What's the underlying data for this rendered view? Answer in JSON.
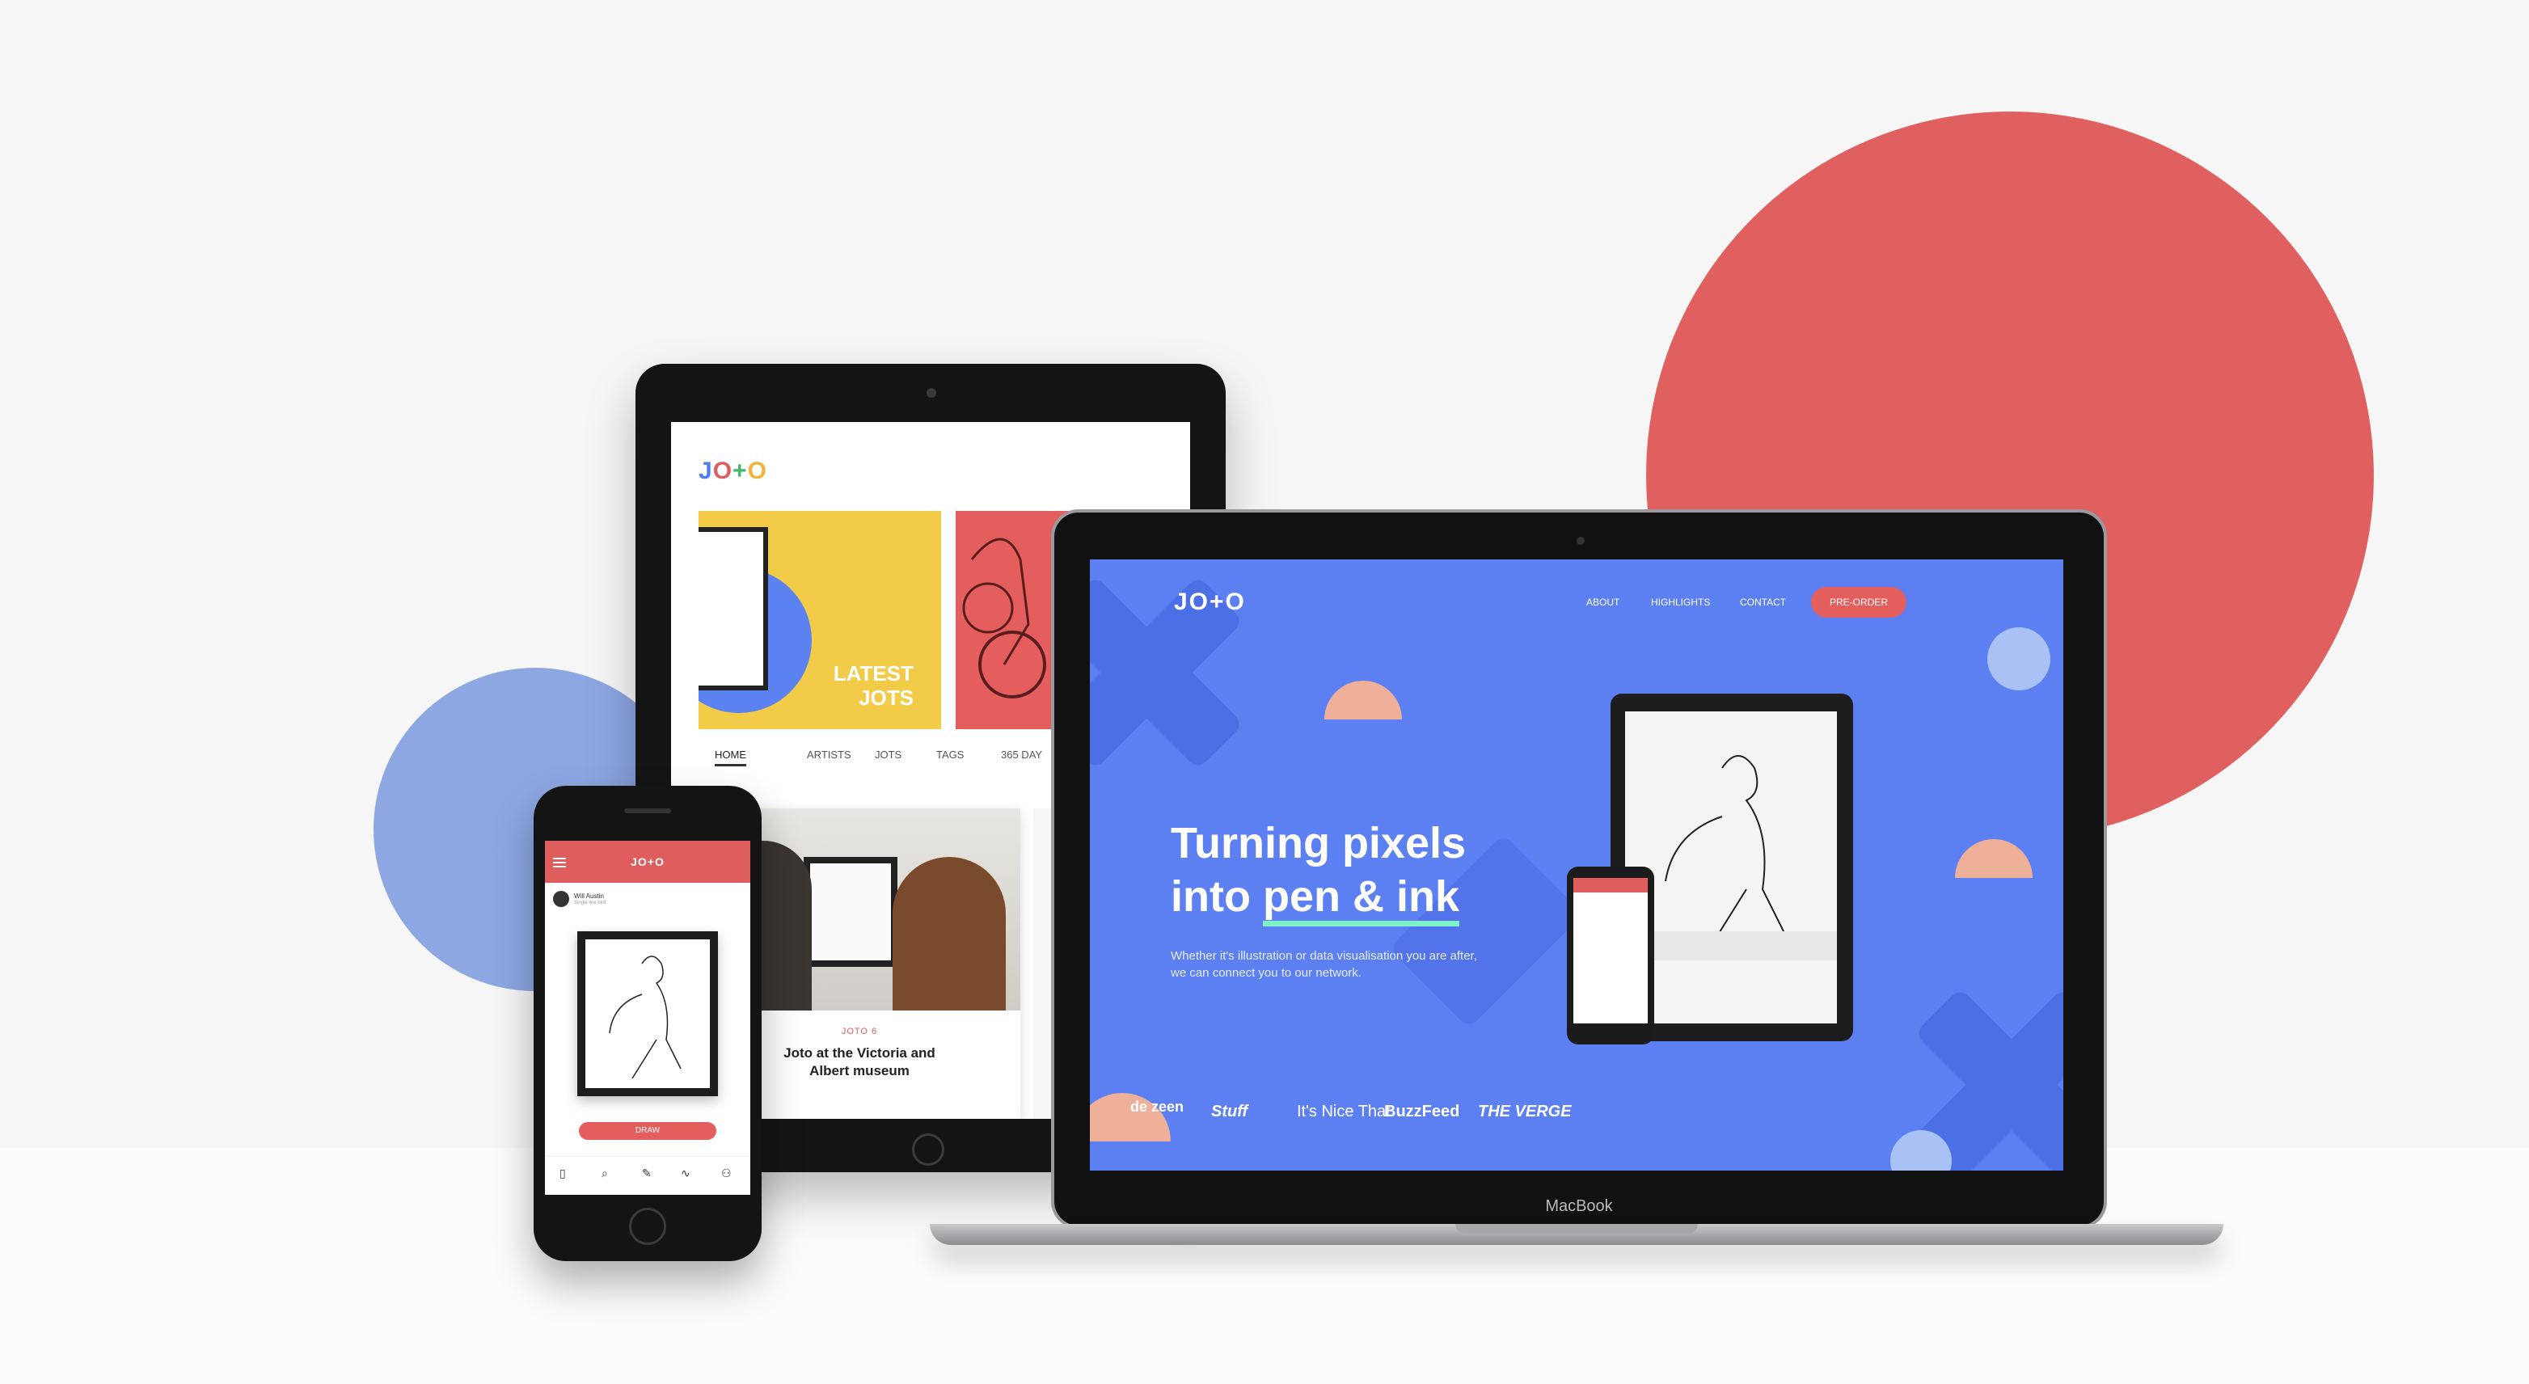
{
  "tablet": {
    "logo": [
      "J",
      "O",
      "+",
      "O"
    ],
    "card1_label_l1": "LATEST",
    "card1_label_l2": "JOTS",
    "nav": [
      "HOME",
      "ARTISTS",
      "JOTS",
      "TAGS",
      "365 DAY"
    ],
    "feature_tag": "JOTO 6",
    "feature_title_l1": "Joto at the Victoria and",
    "feature_title_l2": "Albert museum"
  },
  "laptop": {
    "logo": "JO+O",
    "nav": [
      "ABOUT",
      "HIGHLIGHTS",
      "CONTACT"
    ],
    "cta": "PRE-ORDER",
    "headline_l1": "Turning pixels",
    "headline_l2a": "into ",
    "headline_l2b": "pen & ink",
    "subtext": "Whether it's illustration or data visualisation you are after, we can connect you to our network.",
    "press": [
      "de zeen",
      "Stuff",
      "It's Nice That",
      "BuzzFeed",
      "THE VERGE"
    ],
    "brand": "MacBook",
    "colors": {
      "screen": "#5c7ff2",
      "cta": "#e45e5e",
      "underline": "#7cf2c6"
    }
  },
  "phone": {
    "logo": "JO+O",
    "user_name": "Will Austin",
    "user_sub": "Single line bird",
    "draw_button": "DRAW",
    "tabs": [
      "device-icon",
      "search-icon",
      "pen-icon",
      "activity-icon",
      "profile-icon"
    ]
  },
  "colors": {
    "red_circle": "#e06060",
    "blue_circle": "#8da7e3"
  }
}
